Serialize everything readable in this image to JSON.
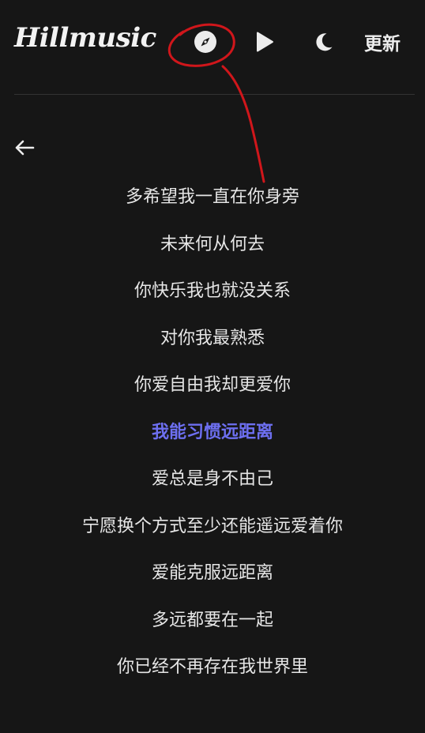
{
  "header": {
    "logo_text": "Hillmusic",
    "update_label": "更新"
  },
  "icons": {
    "compass": "compass-icon",
    "play": "play-icon",
    "moon": "moon-icon",
    "back": "arrow-left-icon"
  },
  "colors": {
    "background": "#161616",
    "active_lyric": "#6d6ff0",
    "annotation": "#d0161b"
  },
  "lyrics": {
    "lines": [
      "多希望我一直在你身旁",
      "未来何从何去",
      "你快乐我也就没关系",
      "对你我最熟悉",
      "你爱自由我却更爱你",
      "我能习惯远距离",
      "爱总是身不由己",
      "宁愿换个方式至少还能遥远爱着你",
      "爱能克服远距离",
      "多远都要在一起",
      "你已经不再存在我世界里"
    ],
    "active_index": 5
  }
}
